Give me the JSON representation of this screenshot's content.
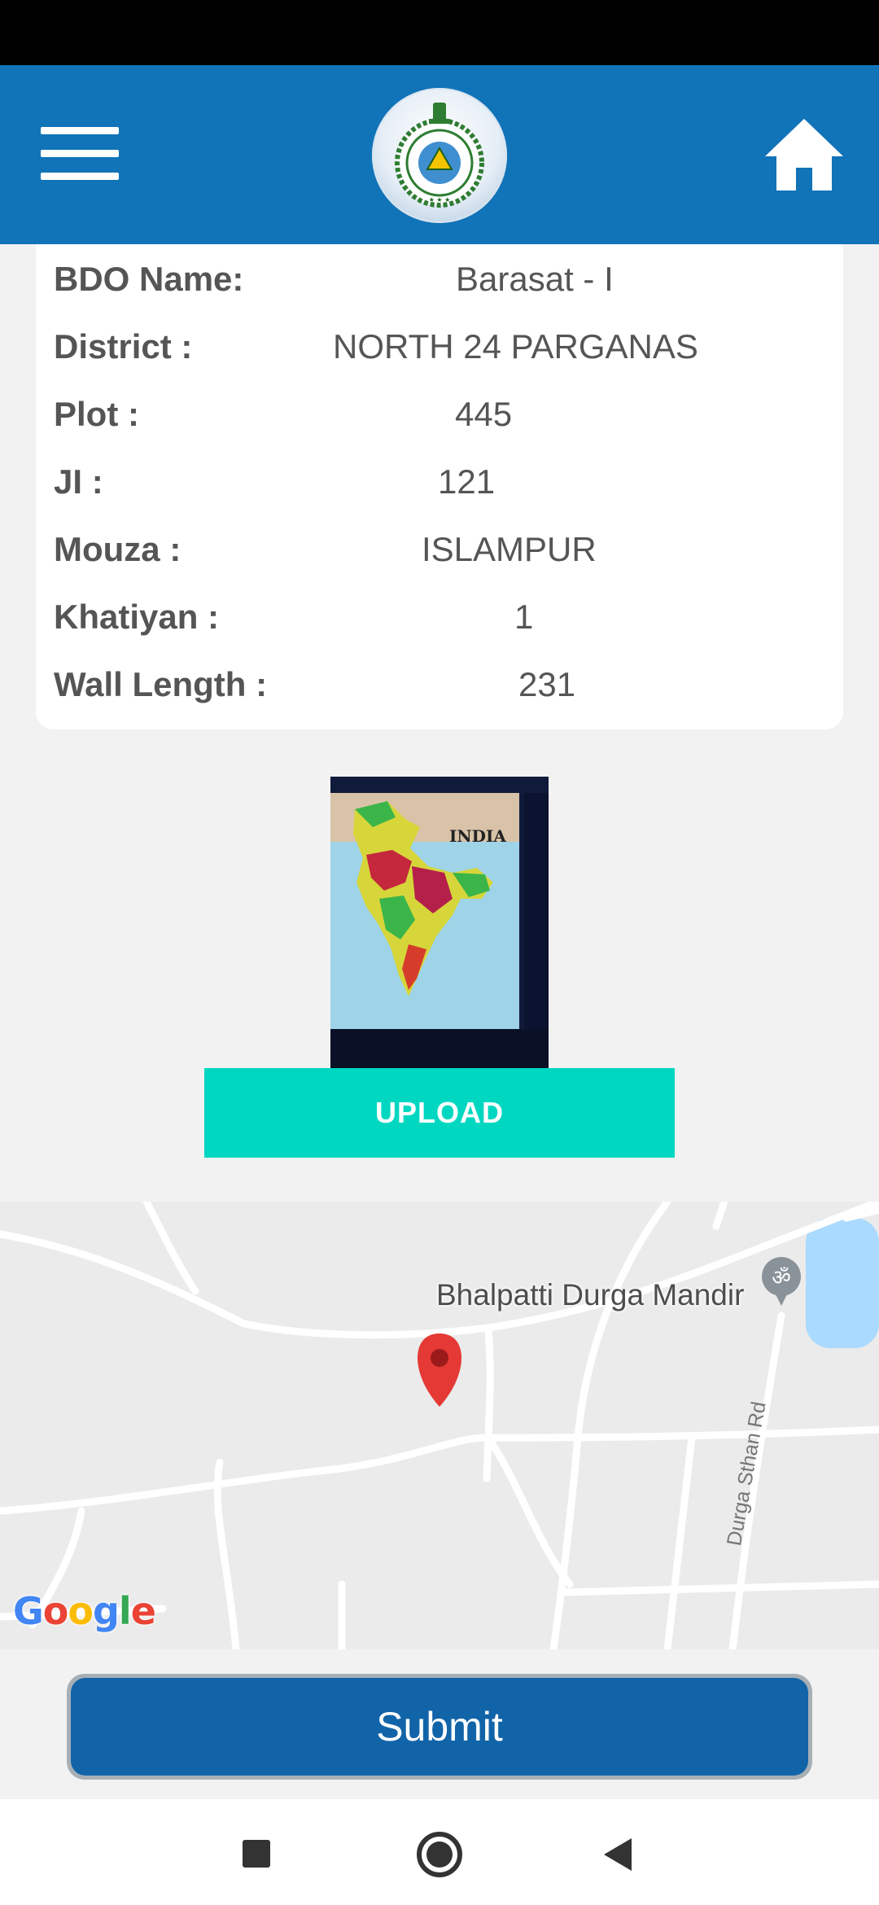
{
  "header": {
    "menu_icon": "menu-icon",
    "logo": "government-emblem",
    "home_icon": "home-icon"
  },
  "details": [
    {
      "label": "BDO Name:",
      "value": "Barasat - I"
    },
    {
      "label": "District :",
      "value": "NORTH 24 PARGANAS"
    },
    {
      "label": "Plot :",
      "value": "445"
    },
    {
      "label": "JI :",
      "value": "121"
    },
    {
      "label": "Mouza :",
      "value": "ISLAMPUR"
    },
    {
      "label": "Khatiyan :",
      "value": "1"
    },
    {
      "label": "Wall Length :",
      "value": "231"
    }
  ],
  "photo": {
    "map_caption": "INDIA"
  },
  "upload_label": "UPLOAD",
  "map": {
    "place_label": "Bhalpatti Durga Mandir",
    "road_label": "Durga Sthan Rd",
    "attribution": "Google"
  },
  "submit_label": "Submit",
  "nav": [
    "recents-icon",
    "home-circle-icon",
    "back-icon"
  ],
  "colors": {
    "header": "#1173b8",
    "upload": "#00d7c1",
    "submit": "#1264a8",
    "marker": "#e53935"
  }
}
